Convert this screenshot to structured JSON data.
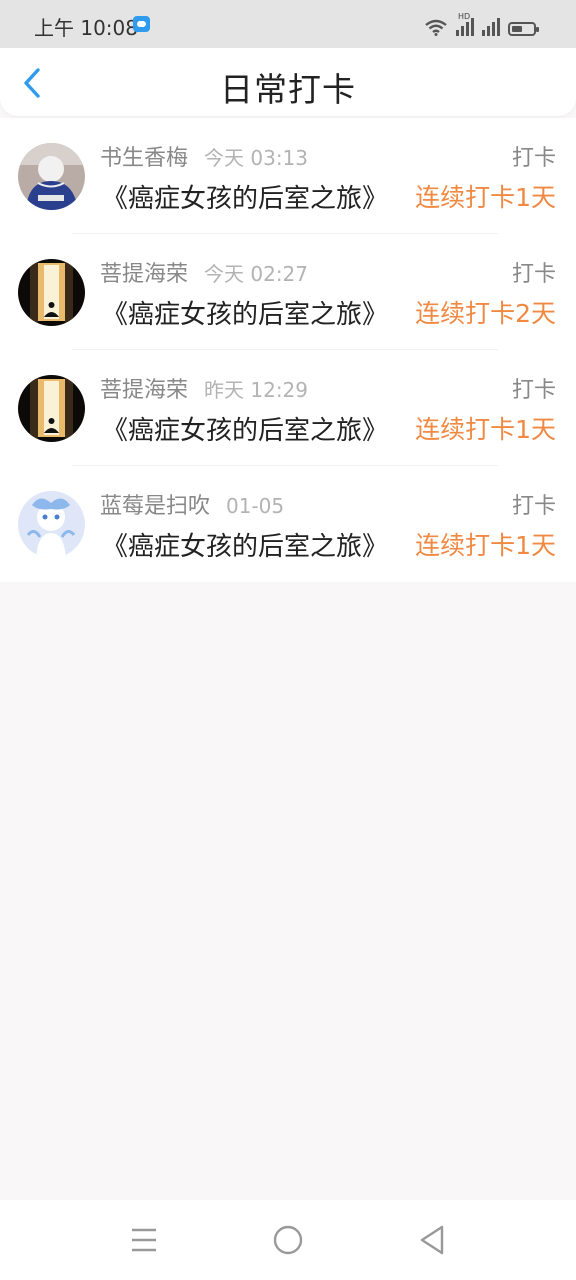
{
  "status_bar": {
    "time": "上午 10:08",
    "hd_label": "HD",
    "icons": [
      "app-notification-icon",
      "wifi-icon",
      "signal-icon",
      "battery-icon"
    ]
  },
  "header": {
    "title": "日常打卡",
    "back_icon": "chevron-left-icon"
  },
  "colors": {
    "accent_orange": "#f08a43",
    "back_blue": "#2e9bf0",
    "muted_text": "#888888",
    "time_text": "#b3b3b3"
  },
  "checkins": [
    {
      "username": "书生香梅",
      "time": "今天 03:13",
      "type": "打卡",
      "book": "《癌症女孩的后室之旅》",
      "streak": "连续打卡1天",
      "avatar": "photo-person-avatar"
    },
    {
      "username": "菩提海荣",
      "time": "今天 02:27",
      "type": "打卡",
      "book": "《癌症女孩的后室之旅》",
      "streak": "连续打卡2天",
      "avatar": "meditation-avatar"
    },
    {
      "username": "菩提海荣",
      "time": "昨天 12:29",
      "type": "打卡",
      "book": "《癌症女孩的后室之旅》",
      "streak": "连续打卡1天",
      "avatar": "meditation-avatar"
    },
    {
      "username": "蓝莓是扫吹",
      "time": "01-05",
      "type": "打卡",
      "book": "《癌症女孩的后室之旅》",
      "streak": "连续打卡1天",
      "avatar": "anime-character-avatar"
    }
  ],
  "navbar": {
    "icons": [
      "menu-icon",
      "home-icon",
      "back-icon"
    ]
  }
}
